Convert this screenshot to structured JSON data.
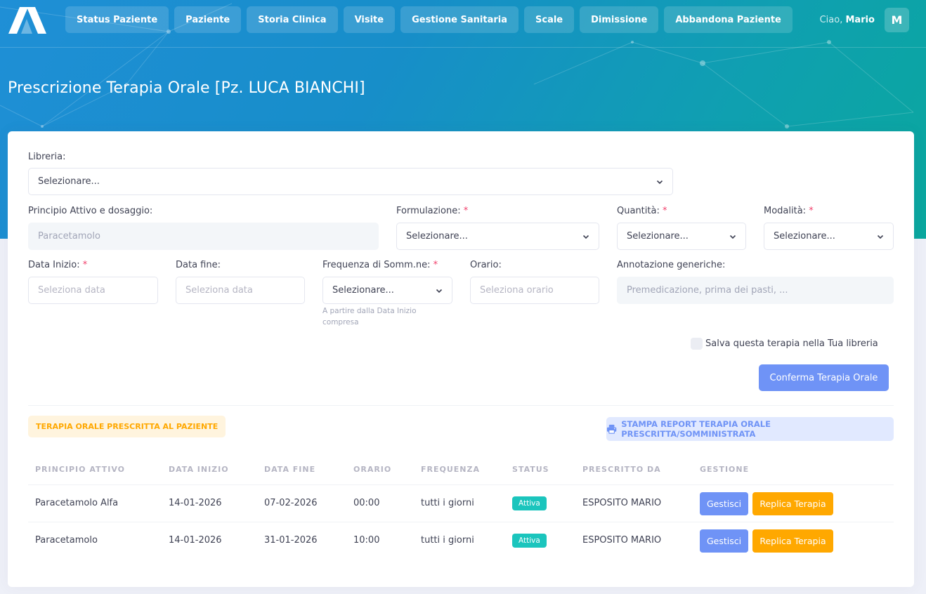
{
  "colors": {
    "accent": "#6f93f6",
    "warning": "#ffa800",
    "success": "#1bc5bd",
    "danger": "#f1416c"
  },
  "nav": {
    "logo": "app-logo-icon",
    "items": [
      {
        "label": "Status Paziente"
      },
      {
        "label": "Paziente"
      },
      {
        "label": "Storia Clinica"
      },
      {
        "label": "Visite"
      },
      {
        "label": "Gestione Sanitaria"
      },
      {
        "label": "Scale"
      },
      {
        "label": "Dimissione"
      },
      {
        "label": "Abbandona Paziente"
      }
    ]
  },
  "user": {
    "greeting": "Ciao,",
    "name": "Mario",
    "initial": "M"
  },
  "page": {
    "title": "Prescrizione Terapia Orale [Pz. LUCA BIANCHI]"
  },
  "form": {
    "libreria": {
      "label": "Libreria:",
      "value": "Selezionare..."
    },
    "principio": {
      "label": "Principio Attivo e dosaggio:",
      "placeholder": "Paracetamolo"
    },
    "formulazione": {
      "label": "Formulazione:",
      "value": "Selezionare..."
    },
    "quantita": {
      "label": "Quantità:",
      "value": "Selezionare..."
    },
    "modalita": {
      "label": "Modalità:",
      "value": "Selezionare..."
    },
    "data_inizio": {
      "label": "Data Inizio:",
      "placeholder": "Seleziona data"
    },
    "data_fine": {
      "label": "Data fine:",
      "placeholder": "Seleziona data"
    },
    "frequenza": {
      "label": "Frequenza di Somm.ne:",
      "value": "Selezionare...",
      "hint": "A partire dalla Data Inizio compresa"
    },
    "orario": {
      "label": "Orario:",
      "placeholder": "Seleziona orario"
    },
    "annotazione": {
      "label": "Annotazione generiche:",
      "placeholder": "Premedicazione, prima dei pasti, ..."
    },
    "required_mark": "*",
    "save_label": "Salva questa terapia nella Tua libreria",
    "confirm_label": "Conferma Terapia Orale"
  },
  "prescribed": {
    "badge": "TERAPIA ORALE PRESCRITTA AL PAZIENTE",
    "print_label": "STAMPA REPORT TERAPIA ORALE PRESCRITTA/SOMMINISTRATA",
    "print_icon": "printer-icon",
    "columns": [
      "PRINCIPIO ATTIVO",
      "DATA INIZIO",
      "DATA FINE",
      "ORARIO",
      "FREQUENZA",
      "STATUS",
      "PRESCRITTO DA",
      "GESTIONE"
    ],
    "rows": [
      {
        "principio": "Paracetamolo Alfa",
        "inizio": "14-01-2026",
        "fine": "07-02-2026",
        "orario": "00:00",
        "frequenza": "tutti i giorni",
        "status": "Attiva",
        "prescritto": "ESPOSITO MARIO"
      },
      {
        "principio": "Paracetamolo",
        "inizio": "14-01-2026",
        "fine": "31-01-2026",
        "orario": "10:00",
        "frequenza": "tutti i giorni",
        "status": "Attiva",
        "prescritto": "ESPOSITO MARIO"
      }
    ],
    "manage_label": "Gestisci",
    "replicate_label": "Replica Terapia"
  }
}
